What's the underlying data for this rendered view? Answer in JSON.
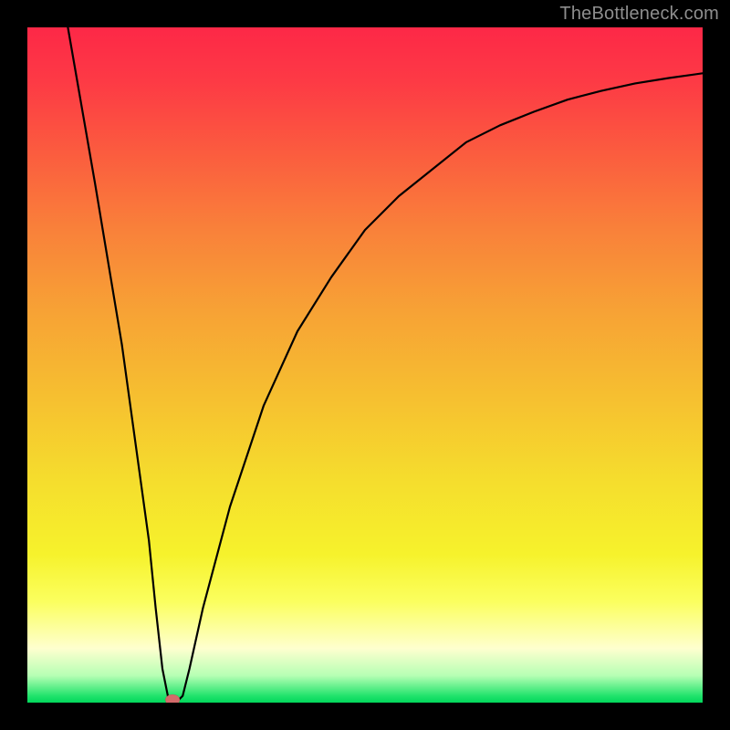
{
  "watermark": {
    "text": "TheBottleneck.com"
  },
  "colors": {
    "frame": "#000000",
    "curve": "#000000",
    "marker": "#d36a6a",
    "gradient_stops": [
      "#fd2847",
      "#fd3a45",
      "#fb5a3f",
      "#f9813a",
      "#f7a235",
      "#f6c030",
      "#f5dd2d",
      "#f6f22c",
      "#fbff5e",
      "#feffcf",
      "#b6ffb4",
      "#21e36c",
      "#02d75b"
    ]
  },
  "chart_data": {
    "type": "line",
    "title": "",
    "xlabel": "",
    "ylabel": "",
    "xlim": [
      0,
      100
    ],
    "ylim": [
      0,
      100
    ],
    "grid": false,
    "legend": false,
    "series": [
      {
        "name": "bottleneck-curve",
        "x": [
          6,
          10,
          14,
          18,
          19,
          20,
          21,
          22,
          23,
          24,
          26,
          30,
          35,
          40,
          45,
          50,
          55,
          60,
          65,
          70,
          75,
          80,
          85,
          90,
          95,
          100
        ],
        "y": [
          100,
          77,
          53,
          24,
          14,
          5,
          0,
          0,
          1,
          5,
          14,
          29,
          44,
          55,
          63,
          70,
          75,
          79,
          83,
          85.5,
          87.5,
          89.3,
          90.6,
          91.7,
          92.5,
          93.2
        ]
      }
    ],
    "marker": {
      "x": 21.5,
      "y": 0
    }
  }
}
